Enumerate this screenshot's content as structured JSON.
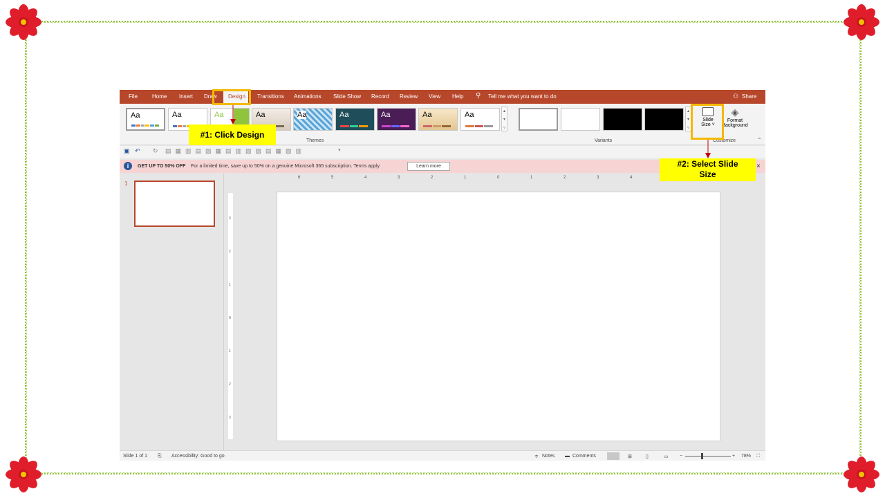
{
  "tutorial": {
    "step1": "#1: Click Design",
    "step2_line1": "#2: Select Slide",
    "step2_line2": "Size"
  },
  "tabs": {
    "file": "File",
    "home": "Home",
    "insert": "Insert",
    "draw": "Draw",
    "design": "Design",
    "transitions": "Transitions",
    "animations": "Animations",
    "slideshow": "Slide Show",
    "record": "Record",
    "review": "Review",
    "view": "View",
    "help": "Help",
    "tellme": "Tell me what you want to do",
    "share": "Share"
  },
  "ribbon": {
    "themes_label": "Themes",
    "variants_label": "Variants",
    "customize_label": "Customize",
    "theme_sample": "Aa",
    "slide_size_line1": "Slide",
    "slide_size_line2": "Size ˅",
    "format_bg_line1": "Format",
    "format_bg_line2": "Background"
  },
  "message_bar": {
    "headline": "GET UP TO 50% OFF",
    "text": "For a limited time, save up to 50% on a genuine Microsoft 365 subscription. Terms apply.",
    "button": "Learn more",
    "close": "×"
  },
  "slides_pane": {
    "slide_number": "1"
  },
  "ruler": {
    "h_ticks": [
      "6",
      "5",
      "4",
      "3",
      "2",
      "1",
      "0",
      "1",
      "2",
      "3",
      "4"
    ],
    "v_ticks": [
      "3",
      "2",
      "1",
      "0",
      "1",
      "2",
      "3"
    ]
  },
  "status": {
    "slide_of": "Slide 1 of 1",
    "accessibility": "Accessibility: Good to go",
    "notes": "Notes",
    "comments": "Comments",
    "zoom": "78%"
  },
  "colors": {
    "accent": "#b7472a",
    "callout": "#ffff00",
    "highlight": "#f5b800",
    "frame": "#8fc43c"
  }
}
